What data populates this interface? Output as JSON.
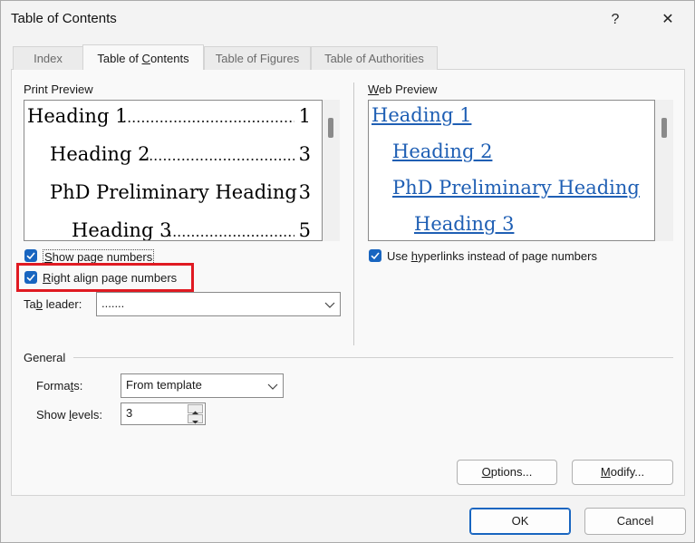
{
  "window": {
    "title": "Table of Contents",
    "help_glyph": "?",
    "close_glyph": "✕"
  },
  "tabs": [
    {
      "label": "Index"
    },
    {
      "label": "Table of Contents"
    },
    {
      "label": "Table of Figures"
    },
    {
      "label": "Table of Authorities"
    }
  ],
  "print_preview": {
    "label": "Print Preview",
    "lines": [
      {
        "text": "Heading 1",
        "page": "1"
      },
      {
        "text": "Heading 2",
        "page": "3"
      },
      {
        "text": "PhD Preliminary Heading",
        "page": "3"
      },
      {
        "text": "Heading 3",
        "page": "5"
      }
    ],
    "leader_dots": "......................................................................................"
  },
  "web_preview": {
    "label": "Web Preview",
    "lines": [
      "Heading 1",
      "Heading 2",
      "PhD Preliminary Heading",
      "Heading 3"
    ]
  },
  "options": {
    "show_page_numbers": "Show page numbers",
    "right_align": "Right align page numbers",
    "use_hyperlinks": "Use hyperlinks instead of page numbers",
    "tab_leader_label": "Tab leader:",
    "tab_leader_value": "......."
  },
  "general": {
    "label": "General",
    "formats_label": "Formats:",
    "formats_value": "From template",
    "show_levels_label": "Show levels:",
    "show_levels_value": "3"
  },
  "buttons": {
    "options": "Options...",
    "modify": "Modify...",
    "ok": "OK",
    "cancel": "Cancel"
  },
  "colors": {
    "accent": "#1865c0",
    "highlight": "#e01a22",
    "hyperlink": "#1f5fb4"
  }
}
